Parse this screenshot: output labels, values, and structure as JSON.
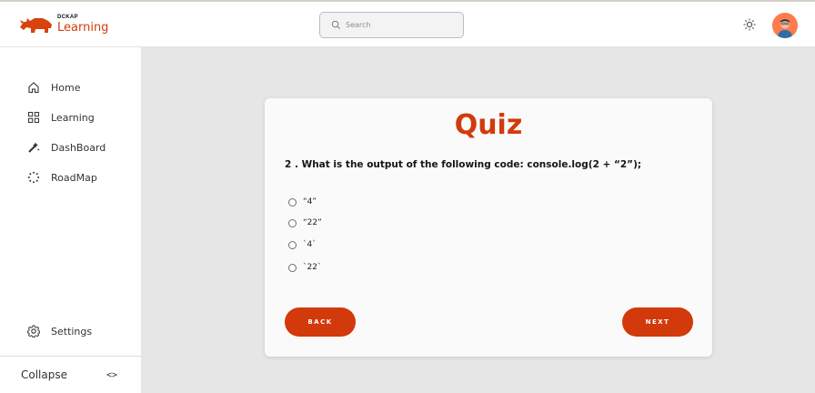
{
  "header": {
    "brand_small": "DCKAP",
    "brand_name": "Learning",
    "search_placeholder": "Search",
    "icons": {
      "logo": "rhino-logo",
      "search": "search-icon",
      "theme": "sun-icon",
      "avatar": "user-avatar"
    }
  },
  "sidebar": {
    "items": [
      {
        "label": "Home",
        "icon": "home-icon"
      },
      {
        "label": "Learning",
        "icon": "grid-icon"
      },
      {
        "label": "DashBoard",
        "icon": "magic-wand-icon"
      },
      {
        "label": "RoadMap",
        "icon": "dotted-circle-icon"
      }
    ],
    "settings_label": "Settings",
    "collapse_label": "Collapse",
    "collapse_icon_text": "<>"
  },
  "quiz": {
    "title": "Quiz",
    "question": "2 . What is the output of the following code: console.log(2 + “2”);",
    "options": [
      "“4”",
      "“22”",
      "`4`",
      "`22`"
    ],
    "back_label": "BACK",
    "next_label": "NEXT"
  },
  "colors": {
    "accent": "#d2390b",
    "page_background": "#e6e6e6",
    "avatar_background": "#ff7a4d"
  }
}
